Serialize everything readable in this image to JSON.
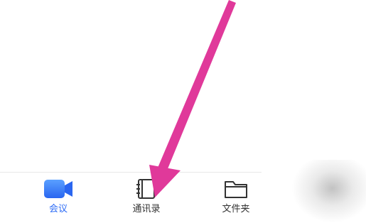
{
  "tabbar": {
    "tabs": [
      {
        "label": "会议",
        "icon": "video-camera-icon",
        "active": true
      },
      {
        "label": "通讯录",
        "icon": "contacts-book-icon",
        "active": false
      },
      {
        "label": "文件夹",
        "icon": "folder-icon",
        "active": false
      }
    ]
  },
  "colors": {
    "active": "#2d6cf6",
    "inactive": "#333333",
    "annotation_arrow": "#e0399a"
  }
}
